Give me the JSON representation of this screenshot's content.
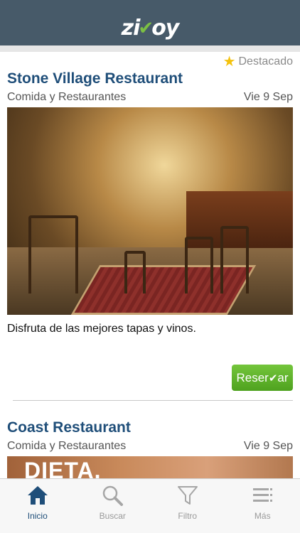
{
  "header": {
    "logo_text_left": "zi",
    "logo_text_right": "oy"
  },
  "feed": {
    "featured_label": "Destacado",
    "cards": [
      {
        "title": "Stone Village Restaurant",
        "category": "Comida y Restaurantes",
        "date": "Vie 9 Sep",
        "description": "Disfruta de las mejores tapas y vinos.",
        "reserve_label_left": "Reser",
        "reserve_label_right": "ar"
      },
      {
        "title": "Coast Restaurant",
        "category": "Comida y Restaurantes",
        "date": "Vie 9 Sep",
        "image_text": "DIETA."
      }
    ]
  },
  "tabbar": {
    "tabs": [
      {
        "label": "Inicio",
        "icon": "home-icon",
        "active": true
      },
      {
        "label": "Buscar",
        "icon": "search-icon",
        "active": false
      },
      {
        "label": "Filtro",
        "icon": "filter-icon",
        "active": false
      },
      {
        "label": "Más",
        "icon": "menu-icon",
        "active": false
      }
    ]
  },
  "colors": {
    "header_bg": "#475a69",
    "title": "#1f4e79",
    "accent_green": "#5cb02a",
    "star": "#f4c20d"
  }
}
